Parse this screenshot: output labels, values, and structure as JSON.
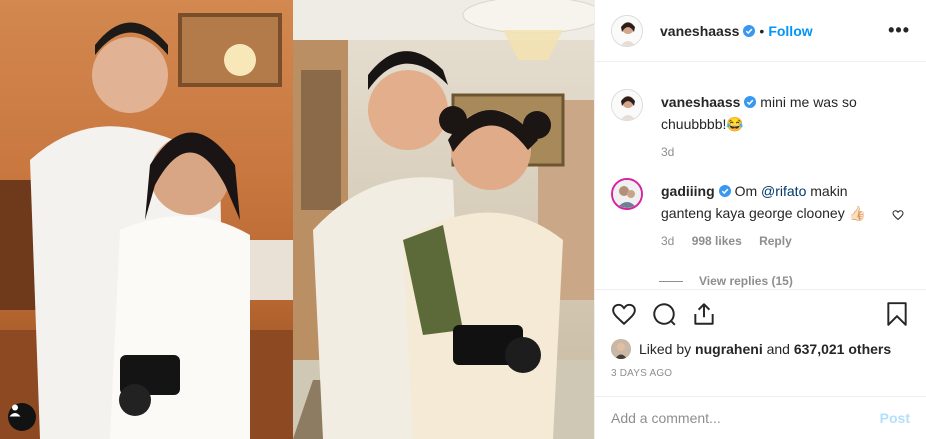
{
  "post": {
    "author": "vaneshaass",
    "follow_label": "Follow",
    "separator": "•",
    "more_icon": "more-horizontal-icon",
    "photo_left_alt": "Then photo",
    "photo_right_alt": "Now photo"
  },
  "caption": {
    "username": "vaneshaass",
    "text": "mini me was so chuubbbb!😂",
    "age": "3d"
  },
  "comment": {
    "username": "gadiiing",
    "text_prefix": "Om ",
    "mention": "@rifato",
    "text_suffix": " makin ganteng kaya george clooney 👍🏻",
    "age": "3d",
    "likes": "998 likes",
    "reply_label": "Reply",
    "view_replies": "View replies (15)"
  },
  "likes": {
    "prefix": "Liked by ",
    "user": "nugraheni",
    "middle": " and ",
    "count": "637,021 others"
  },
  "timestamp": "3 DAYS AGO",
  "add_comment": {
    "placeholder": "Add a comment...",
    "post_label": "Post"
  },
  "colors": {
    "accent": "#0095f6",
    "verified": "#3897f0",
    "post_disabled": "#b2dffc"
  }
}
